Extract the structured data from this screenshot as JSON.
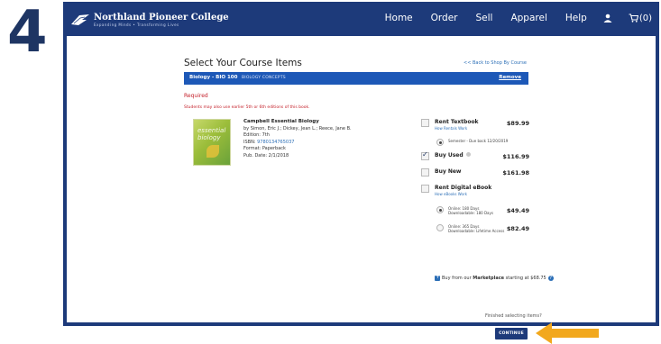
{
  "step_number": "4",
  "header": {
    "logo_name": "Northland Pioneer College",
    "logo_tagline": "Expanding Minds • Transforming Lives",
    "nav": [
      "Home",
      "Order",
      "Sell",
      "Apparel",
      "Help"
    ],
    "cart_count": "(0)"
  },
  "page": {
    "title": "Select Your Course Items",
    "back_link": "<< Back to Shop By Course"
  },
  "course": {
    "code": "Biology - BIO 100",
    "name": "BIOLOGY CONCEPTS",
    "remove_label": "Remove"
  },
  "required_label": "Required",
  "note": "Students may also use earlier 5th or 6th editions of this book.",
  "book": {
    "cover_title": "essential biology",
    "title": "Campbell Essential Biology",
    "authors": "by Simon, Eric J.; Dickey, Jean L.; Reece, Jane B.",
    "edition": "Edition: 7th",
    "isbn_label": "ISBN:",
    "isbn_value": "9780134765037",
    "format": "Format: Paperback",
    "pub_date": "Pub. Date: 2/1/2018"
  },
  "options": {
    "rent_textbook": {
      "label": "Rent Textbook",
      "price": "$89.99",
      "sub": "How Rentals Work",
      "term": "Semester - Due back 12/20/2019"
    },
    "buy_used": {
      "label": "Buy Used",
      "price": "$116.99"
    },
    "buy_new": {
      "label": "Buy New",
      "price": "$161.98"
    },
    "rent_ebook": {
      "label": "Rent Digital eBook",
      "sub": "How eBooks Work",
      "online180": {
        "l1": "Online: 180 Days",
        "l2": "Downloadable: 180 Days",
        "price": "$49.49"
      },
      "online365": {
        "l1": "Online: 365 Days",
        "l2": "Downloadable: Lifetime Access",
        "price": "$82.49"
      }
    }
  },
  "marketplace": {
    "prefix": "Buy from our ",
    "bold": "Marketplace",
    "suffix": " starting at $68.75"
  },
  "finished": "Finished selecting items?",
  "continue_label": "CONTINUE",
  "colors": {
    "brand": "#1d3a7a",
    "course_bar": "#1d58b7",
    "required": "#c4202a",
    "arrow": "#f2a81d"
  }
}
